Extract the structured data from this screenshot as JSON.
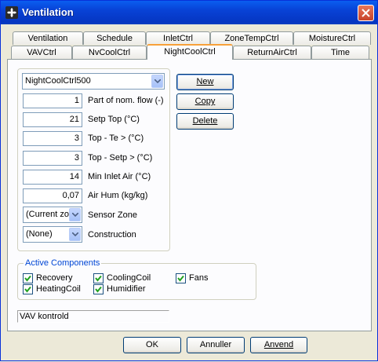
{
  "window": {
    "title": "Ventilation",
    "app_icon": "fan-icon"
  },
  "tabs_row1": [
    "Ventilation",
    "Schedule",
    "InletCtrl",
    "ZoneTempCtrl",
    "MoistureCtrl"
  ],
  "tabs_row2": [
    "VAVCtrl",
    "NvCoolCtrl",
    "NightCoolCtrl",
    "ReturnAirCtrl",
    "Time"
  ],
  "active_tab": "NightCoolCtrl",
  "controller_select": {
    "value": "NightCoolCtrl500"
  },
  "fields": [
    {
      "value": "1",
      "label": "Part of nom. flow (-)"
    },
    {
      "value": "21",
      "label": "Setp Top (°C)"
    },
    {
      "value": "3",
      "label": "Top - Te > (°C)"
    },
    {
      "value": "3",
      "label": "Top - Setp > (°C)"
    },
    {
      "value": "14",
      "label": "Min Inlet Air (°C)"
    },
    {
      "value": "0,07",
      "label": "Air Hum (kg/kg)"
    }
  ],
  "sensor_zone": {
    "value": "(Current zo",
    "label": "Sensor Zone"
  },
  "construction": {
    "value": "(None)",
    "label": "Construction"
  },
  "side_buttons": {
    "new": "New",
    "copy": "Copy",
    "delete": "Delete"
  },
  "active_components": {
    "legend": "Active Components",
    "items": [
      {
        "label": "Recovery",
        "checked": true
      },
      {
        "label": "CoolingCoil",
        "checked": true
      },
      {
        "label": "Fans",
        "checked": true
      },
      {
        "label": "HeatingCoil",
        "checked": true
      },
      {
        "label": "Humidifier",
        "checked": true
      }
    ]
  },
  "status_text": "VAV kontrold",
  "footer": {
    "ok": "OK",
    "cancel": "Annuller",
    "apply": "Anvend"
  }
}
